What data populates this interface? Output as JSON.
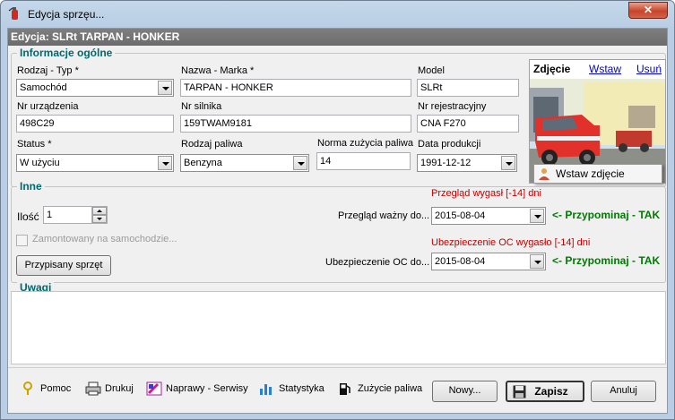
{
  "window": {
    "title": "Edycja sprzęu...",
    "close_label": "✕"
  },
  "header": {
    "title": "Edycja: SLRt TARPAN - HONKER"
  },
  "general": {
    "group_title": "Informacje ogólne",
    "type_label": "Rodzaj - Typ *",
    "type_value": "Samochód",
    "name_label": "Nazwa - Marka *",
    "name_value": "TARPAN - HONKER",
    "model_label": "Model",
    "model_value": "SLRt",
    "device_no_label": "Nr urządzenia",
    "device_no_value": "498C29",
    "engine_no_label": "Nr silnika",
    "engine_no_value": "159TWAM9181",
    "reg_no_label": "Nr rejestracyjny",
    "reg_no_value": "CNA F270",
    "status_label": "Status *",
    "status_value": "W użyciu",
    "fuel_label": "Rodzaj paliwa",
    "fuel_value": "Benzyna",
    "fuel_norm_label": "Norma zużycia paliwa",
    "fuel_norm_value": "14",
    "prod_date_label": "Data produkcji",
    "prod_date_value": "1991-12-12"
  },
  "photo": {
    "title": "Zdjęcie",
    "insert_link": "Wstaw",
    "delete_link": "Usuń",
    "popup_label": "Wstaw zdjęcie"
  },
  "other": {
    "group_title": "Inne",
    "qty_label": "Ilość",
    "qty_value": "1",
    "mounted_label": "Zamontowany na samochodzie...",
    "assigned_btn": "Przypisany sprzęt",
    "inspection_warning": "Przegląd wygasł [-14] dni",
    "inspection_label": "Przegląd ważny do...",
    "inspection_value": "2015-08-04",
    "inspection_reminder": "<- Przypominaj - TAK",
    "insurance_warning": "Ubezpieczenie OC wygasło [-14] dni",
    "insurance_label": "Ubezpieczenie OC do...",
    "insurance_value": "2015-08-04",
    "insurance_reminder": "<- Przypominaj - TAK"
  },
  "notes": {
    "group_title": "Uwagi",
    "value": ""
  },
  "toolbar": {
    "help": "Pomoc",
    "print": "Drukuj",
    "repairs": "Naprawy - Serwisy",
    "stats": "Statystyka",
    "fuel_usage": "Zużycie paliwa",
    "new": "Nowy...",
    "save": "Zapisz",
    "cancel": "Anuluj"
  },
  "colors": {
    "warning": "#c00000",
    "reminder": "#007a00",
    "group_title": "#00686f"
  }
}
